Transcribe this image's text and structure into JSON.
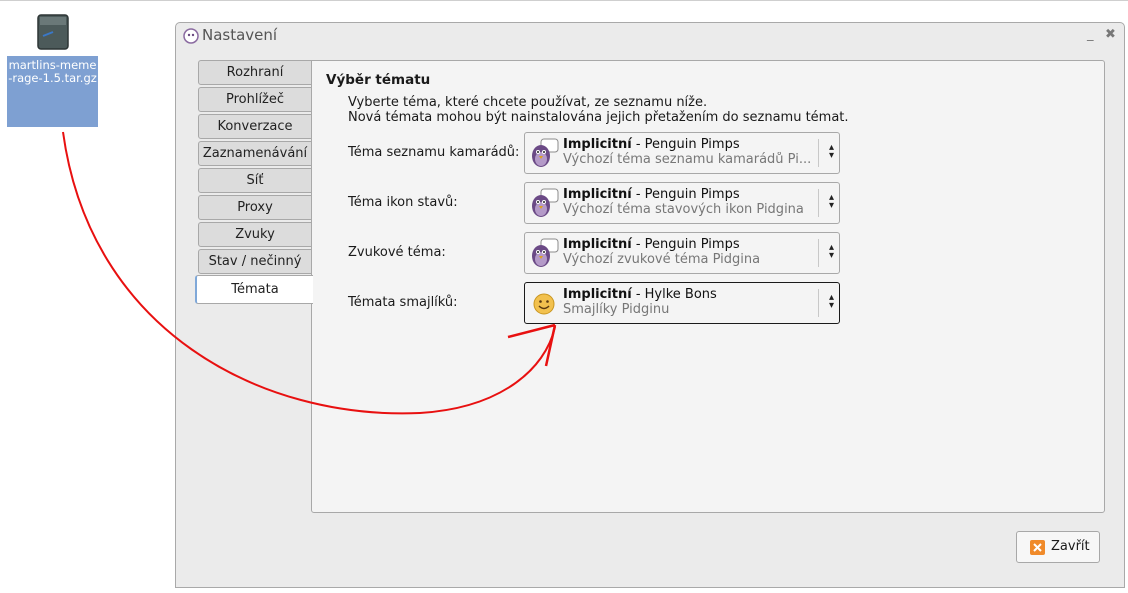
{
  "desktop": {
    "icon_label": "martlins-meme-rage-1.5.tar.gz"
  },
  "window": {
    "title": "Nastavení",
    "minimize_glyph": "_",
    "close_glyph": "✖"
  },
  "tabs": [
    {
      "label": "Rozhraní"
    },
    {
      "label": "Prohlížeč"
    },
    {
      "label": "Konverzace"
    },
    {
      "label": "Zaznamenávání"
    },
    {
      "label": "Síť"
    },
    {
      "label": "Proxy"
    },
    {
      "label": "Zvuky"
    },
    {
      "label": "Stav / nečinný"
    },
    {
      "label": "Témata",
      "active": true
    }
  ],
  "panel": {
    "title": "Výběr tématu",
    "desc1": "Vyberte téma, které chcete používat, ze seznamu níže.",
    "desc2": "Nová témata mohou být nainstalována jejich přetažením do seznamu témat.",
    "rows": [
      {
        "label": "Téma seznamu kamarádů:",
        "name": "Implicitní",
        "author": " - Penguin Pimps",
        "desc": "Výchozí téma seznamu kamarádů Pi...",
        "icon": "pidgin-icon"
      },
      {
        "label": "Téma ikon stavů:",
        "name": "Implicitní",
        "author": " - Penguin Pimps",
        "desc": "Výchozí téma stavových ikon Pidgina",
        "icon": "pidgin-icon"
      },
      {
        "label": "Zvukové téma:",
        "name": "Implicitní",
        "author": " - Penguin Pimps",
        "desc": "Výchozí zvukové téma Pidgina",
        "icon": "pidgin-icon"
      },
      {
        "label": "Témata smajlíků:",
        "name": "Implicitní",
        "author": " - Hylke Bons",
        "desc": "Smajlíky Pidginu",
        "icon": "smiley-icon"
      }
    ]
  },
  "footer": {
    "close_label": "Zavřít"
  },
  "colors": {
    "annotation": "#e81010",
    "selection": "#7ea0d2"
  }
}
